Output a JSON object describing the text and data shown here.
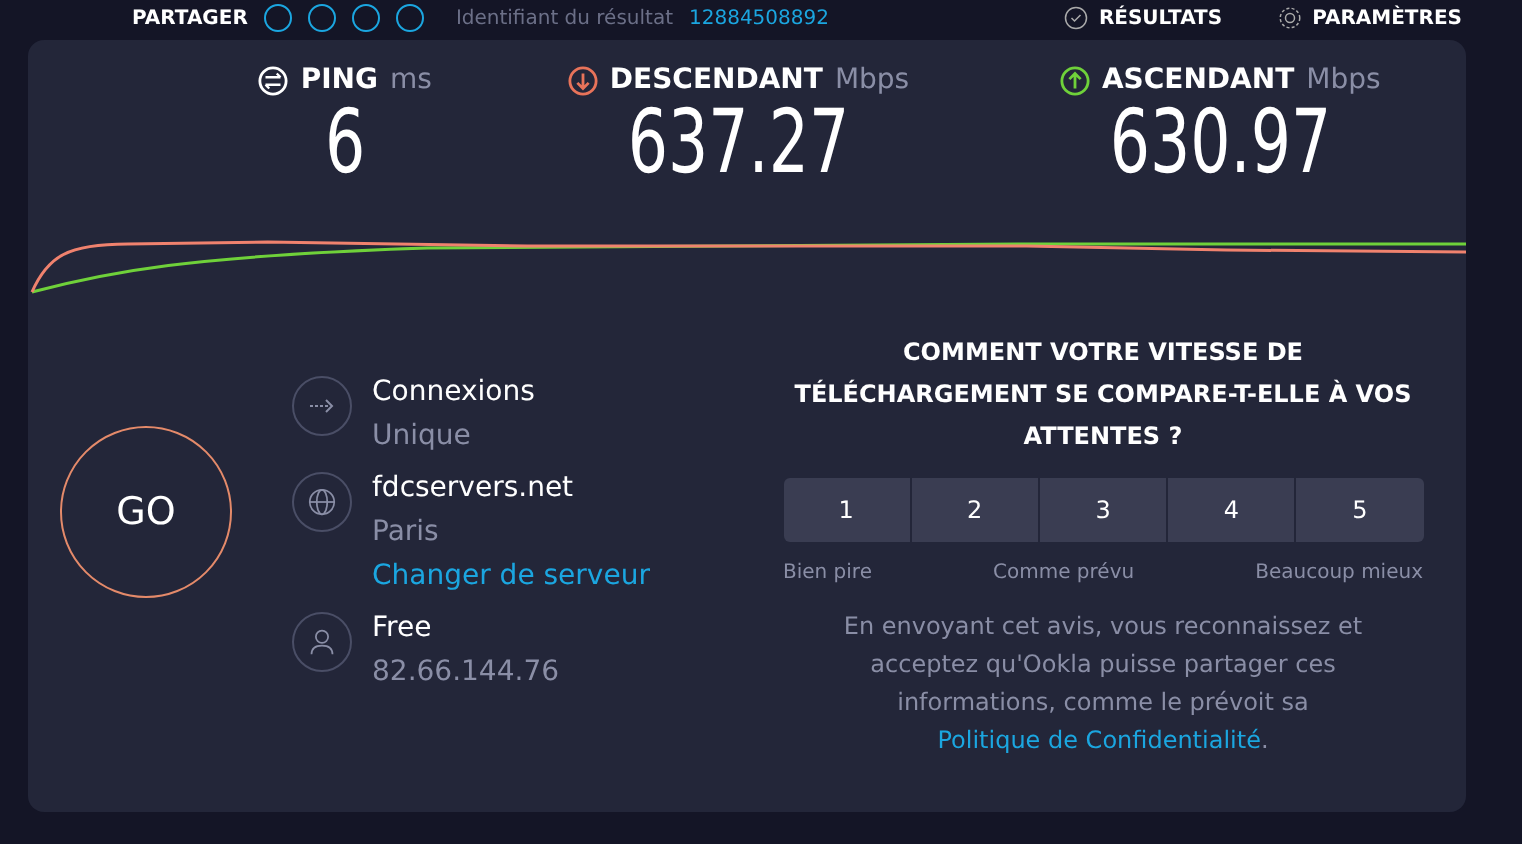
{
  "top_bar": {
    "share_label": "PARTAGER",
    "result_label": "Identifiant du résultat",
    "result_id": "12884508892",
    "results_link": "RÉSULTATS",
    "settings_link": "PARAMÈTRES"
  },
  "metrics": [
    {
      "kind": "ping",
      "label": "PING",
      "unit": "ms",
      "value": "6"
    },
    {
      "kind": "download",
      "label": "DESCENDANT",
      "unit": "Mbps",
      "value": "637.27"
    },
    {
      "kind": "upload",
      "label": "ASCENDANT",
      "unit": "Mbps",
      "value": "630.97"
    }
  ],
  "go_button": "GO",
  "info": [
    {
      "kind": "connections",
      "title": "Connexions",
      "subtitle": "Unique"
    },
    {
      "kind": "server",
      "title": "fdcservers.net",
      "subtitle": "Paris",
      "link": "Changer de serveur"
    },
    {
      "kind": "provider",
      "title": "Free",
      "subtitle": "82.66.144.76"
    }
  ],
  "survey": {
    "question": "COMMENT VOTRE VITESSE DE TÉLÉCHARGEMENT SE COMPARE-T-ELLE À VOS ATTENTES ?",
    "options": [
      {
        "label": "1",
        "selected": false
      },
      {
        "label": "2",
        "selected": false
      },
      {
        "label": "3",
        "selected": false
      },
      {
        "label": "4",
        "selected": false
      },
      {
        "label": "5",
        "selected": false
      }
    ],
    "scale_labels": [
      "Bien pire",
      "Comme prévu",
      "Beaucoup mieux"
    ],
    "disclaimer": "En envoyant cet avis, vous reconnaissez et acceptez qu'Ookla puisse partager ces informations, comme le prévoit sa",
    "policy_link": "Politique de Confidentialité",
    "disclaimer_end": "."
  }
}
